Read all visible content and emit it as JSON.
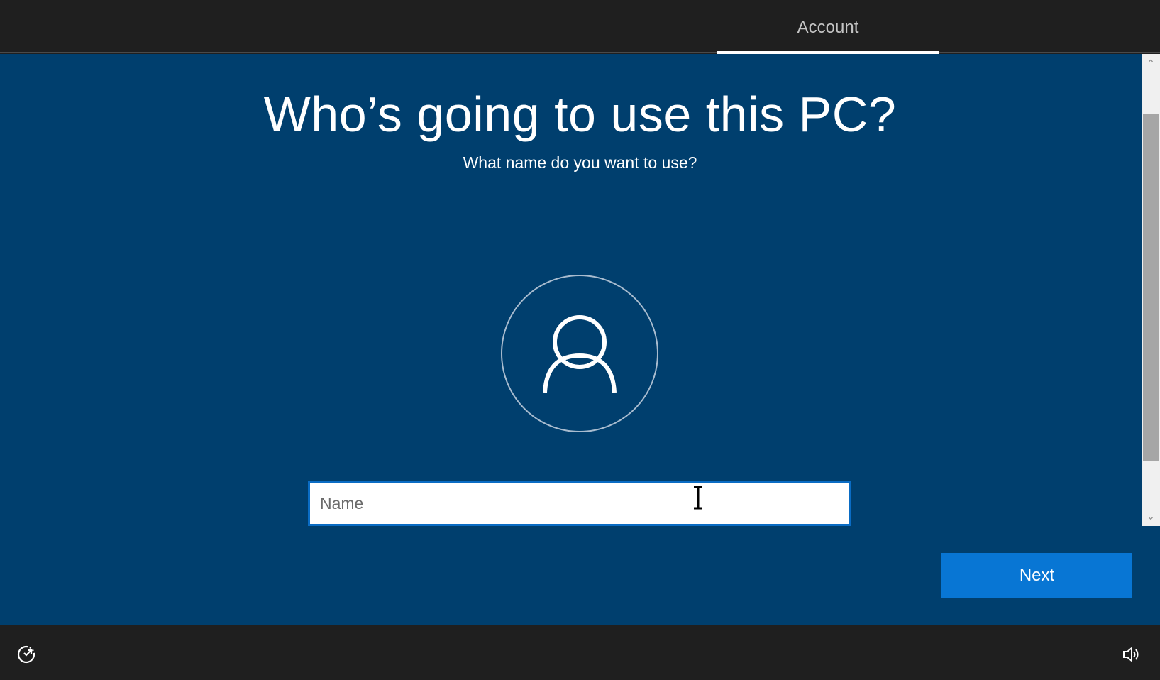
{
  "header": {
    "active_tab": "Account"
  },
  "main": {
    "title": "Who’s going to use this PC?",
    "subtitle": "What name do you want to use?",
    "avatar_icon": "person-icon",
    "name_input": {
      "placeholder": "Name",
      "value": ""
    },
    "next_label": "Next"
  },
  "footer": {
    "left_icon": "ease-of-access-icon",
    "right_icon": "volume-icon"
  },
  "colors": {
    "background_dark": "#1f1f1f",
    "panel_blue": "#003f6e",
    "accent": "#0876d4",
    "input_border": "#0a6cc4"
  }
}
